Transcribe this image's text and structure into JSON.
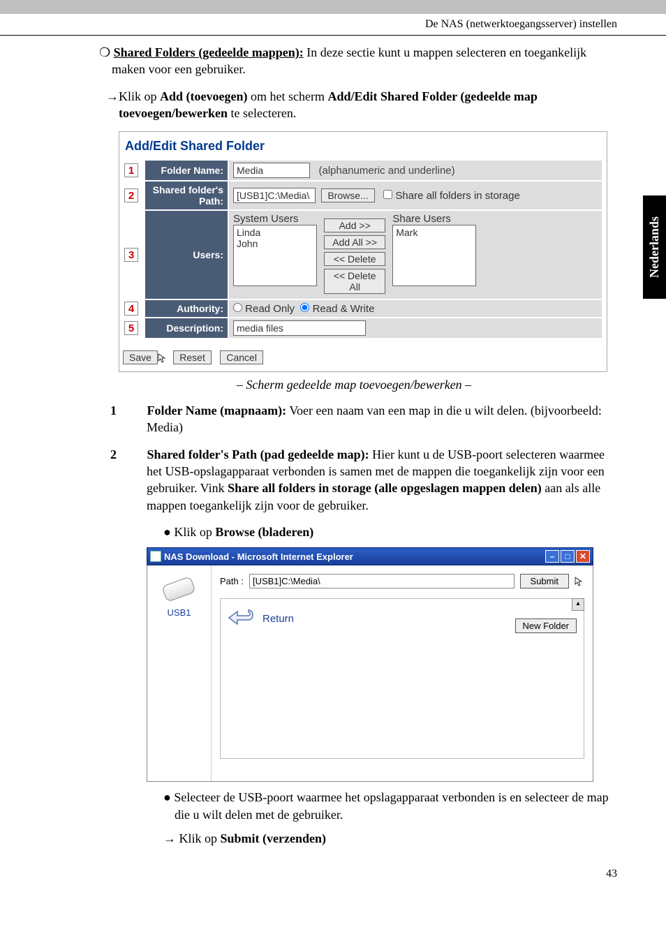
{
  "header": "De NAS (netwerktoegangsserver) instellen",
  "sidetab": "Nederlands",
  "pagenum": "43",
  "intro": {
    "bullet": "❍",
    "title": "Shared Folders (gedeelde mappen):",
    "rest": " In deze sectie kunt u mappen selecteren en toegankelijk maken voor een gebruiker."
  },
  "step": {
    "arrow": "→",
    "pre": "Klik op ",
    "add": "Add (toevoegen)",
    "mid": " om het scherm ",
    "dlg": "Add/Edit Shared Folder (gedeelde map toevoegen/bewerken",
    "post": " te selecteren."
  },
  "ss1": {
    "title": "Add/Edit Shared Folder",
    "n1": "1",
    "lab1": "Folder Name:",
    "val1": "Media",
    "hint1": "(alphanumeric and underline)",
    "n2": "2",
    "lab2": "Shared folder's Path:",
    "val2": "[USB1]C:\\Media\\",
    "browse": "Browse...",
    "chk2": "Share all folders in storage",
    "n3": "3",
    "lab3": "Users:",
    "sys_h": "System Users",
    "sys1": "Linda",
    "sys2": "John",
    "btn_add": "Add >>",
    "btn_addall": "Add All >>",
    "btn_del": "<< Delete",
    "btn_delall": "<< Delete All",
    "sh_h": "Share Users",
    "sh1": "Mark",
    "n4": "4",
    "lab4": "Authority:",
    "ro": "Read Only",
    "rw": "Read & Write",
    "n5": "5",
    "lab5": "Description:",
    "val5": "media files",
    "b_save": "Save",
    "b_reset": "Reset",
    "b_cancel": "Cancel"
  },
  "caption1": "– Scherm gedeelde map toevoegen/bewerken –",
  "items": {
    "i1_n": "1",
    "i1_b": "Folder Name (mapnaam):",
    "i1_t": " Voer een naam van een map in die u wilt delen. (bijvoorbeeld: Media)",
    "i2_n": "2",
    "i2_b": "Shared folder's Path (pad gedeelde map):",
    "i2_t1": " Hier kunt u de USB-poort selecteren waarmee het USB-opslagapparaat verbonden is samen met de mappen die toegankelijk zijn voor een gebruiker. Vink ",
    "i2_b2": "Share all folders in storage (alle opgeslagen mappen delen)",
    "i2_t2": " aan als alle mappen toegankelijk zijn voor de gebruiker.",
    "sub1_pre": "Klik op ",
    "sub1_b": "Browse (bladeren)"
  },
  "ss2": {
    "title": "NAS Download - Microsoft Internet Explorer",
    "usb": "USB1",
    "pathlab": "Path :",
    "pathval": "[USB1]C:\\Media\\",
    "submit": "Submit",
    "return": "Return",
    "newfolder": "New Folder"
  },
  "after": {
    "sub2": "Selecteer de USB-poort waarmee het opslagapparaat verbonden is en selecteer de map die u wilt delen met de gebruiker.",
    "arrow": "→",
    "sub3_pre": "  Klik op ",
    "sub3_b": "Submit (verzenden)"
  }
}
